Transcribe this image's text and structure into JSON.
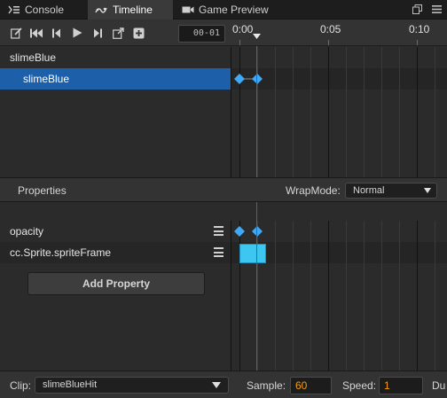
{
  "tabs": [
    {
      "label": "Console",
      "icon": "console-icon"
    },
    {
      "label": "Timeline",
      "icon": "timeline-icon"
    },
    {
      "label": "Game Preview",
      "icon": "camera-icon"
    }
  ],
  "toolbar": {
    "buttons": [
      "edit-icon",
      "jump-start-icon",
      "prev-frame-icon",
      "play-icon",
      "next-frame-icon",
      "export-icon",
      "add-event-icon"
    ],
    "current_frame": "00-01"
  },
  "ruler": {
    "labels": [
      "0:00",
      "0:05",
      "0:10"
    ]
  },
  "nodes": {
    "root": "slimeBlue",
    "child": "slimeBlue"
  },
  "properties": {
    "title": "Properties",
    "wrap_label": "WrapMode:",
    "wrap_value": "Normal",
    "items": [
      "opacity",
      "cc.Sprite.spriteFrame"
    ],
    "add_button": "Add Property"
  },
  "bottom": {
    "clip_label": "Clip:",
    "clip_value": "slimeBlueHit",
    "sample_label": "Sample:",
    "sample_value": "60",
    "speed_label": "Speed:",
    "speed_value": "1",
    "duration_label": "Du"
  },
  "colors": {
    "selection": "#1d5fa8",
    "keyframe": "#3fa9f5",
    "playhead": "#c0392b",
    "number_accent": "#f39c12"
  }
}
